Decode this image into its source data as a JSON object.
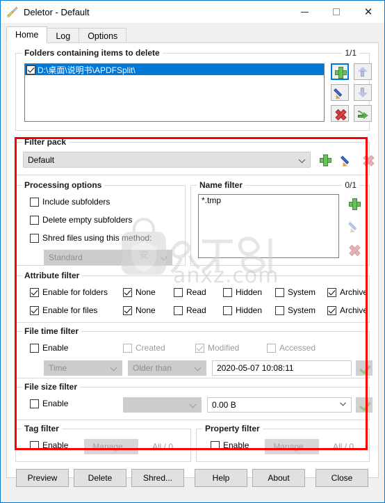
{
  "window": {
    "title": "Deletor - Default",
    "icon": "broom-icon",
    "minimize": "—",
    "maximize": "□",
    "close": "✕"
  },
  "tabs": [
    {
      "label": "Home",
      "active": true
    },
    {
      "label": "Log",
      "active": false
    },
    {
      "label": "Options",
      "active": false
    }
  ],
  "folders_group": {
    "caption": "Folders containing items to delete",
    "counter": "1/1",
    "items": [
      {
        "path": "D:\\桌面\\说明书\\APDFSplit\\",
        "checked": true,
        "selected": true
      }
    ],
    "buttons": {
      "add": "add-icon",
      "move_up": "arrow-up-icon",
      "edit": "pencil-icon",
      "move_down": "arrow-down-icon",
      "remove": "delete-x-icon",
      "open": "go-arrow-icon"
    }
  },
  "filter_pack": {
    "caption": "Filter pack",
    "selected": "Default",
    "buttons": {
      "add": "add-icon",
      "edit": "pencil-icon",
      "delete": "delete-x-icon"
    }
  },
  "processing_options": {
    "caption": "Processing options",
    "include_subfolders": {
      "label": "Include subfolders",
      "checked": false
    },
    "delete_empty_subfolders": {
      "label": "Delete empty subfolders",
      "checked": false
    },
    "shred_files": {
      "label": "Shred files using this method:",
      "checked": false
    },
    "shred_method": {
      "value": "Standard",
      "enabled": false
    }
  },
  "name_filter": {
    "caption": "Name filter",
    "counter": "0/1",
    "items": [
      "*.tmp"
    ],
    "buttons": {
      "add": "add-icon",
      "edit": "pencil-icon",
      "delete": "delete-x-icon"
    }
  },
  "attribute_filter": {
    "caption": "Attribute filter",
    "rows": [
      {
        "enable": {
          "label": "Enable for folders",
          "checked": true
        },
        "flags": [
          {
            "label": "None",
            "checked": true
          },
          {
            "label": "Read",
            "checked": false
          },
          {
            "label": "Hidden",
            "checked": false
          },
          {
            "label": "System",
            "checked": false
          },
          {
            "label": "Archive",
            "checked": true
          }
        ]
      },
      {
        "enable": {
          "label": "Enable for files",
          "checked": true
        },
        "flags": [
          {
            "label": "None",
            "checked": true
          },
          {
            "label": "Read",
            "checked": false
          },
          {
            "label": "Hidden",
            "checked": false
          },
          {
            "label": "System",
            "checked": false
          },
          {
            "label": "Archive",
            "checked": true
          }
        ]
      }
    ]
  },
  "file_time_filter": {
    "caption": "File time filter",
    "enable": {
      "label": "Enable",
      "checked": false
    },
    "created": {
      "label": "Created",
      "checked": false,
      "enabled": false
    },
    "modified": {
      "label": "Modified",
      "checked": true,
      "enabled": false
    },
    "accessed": {
      "label": "Accessed",
      "checked": false,
      "enabled": false
    },
    "mode": {
      "value": "Time",
      "enabled": false
    },
    "comparison": {
      "value": "Older than",
      "enabled": false
    },
    "datetime": {
      "value": "2020-05-07 10:08:11"
    },
    "apply": "check-icon"
  },
  "file_size_filter": {
    "caption": "File size filter",
    "enable": {
      "label": "Enable",
      "checked": false
    },
    "comparison": {
      "value": "",
      "enabled": false
    },
    "size": {
      "value": "0.00 B"
    },
    "apply": "check-icon"
  },
  "tag_filter": {
    "caption": "Tag filter",
    "enable": {
      "label": "Enable",
      "checked": false
    },
    "manage": {
      "label": "Manage...",
      "enabled": false
    },
    "counter": "All / 0"
  },
  "property_filter": {
    "caption": "Property filter",
    "enable": {
      "label": "Enable",
      "checked": false
    },
    "manage": {
      "label": "Manage...",
      "enabled": false
    },
    "counter": "All / 0"
  },
  "footer_buttons": [
    {
      "label": "Preview"
    },
    {
      "label": "Delete"
    },
    {
      "label": "Shred..."
    },
    {
      "label": "Help"
    },
    {
      "label": "About"
    },
    {
      "label": "Close"
    }
  ],
  "watermark": {
    "site": "anxz.com"
  },
  "colors": {
    "accent": "#0078d7",
    "selection": "#0078d7",
    "annotation": "#ff0000",
    "window_bg": "#f0f0f0",
    "page_bg": "#ffffff"
  }
}
